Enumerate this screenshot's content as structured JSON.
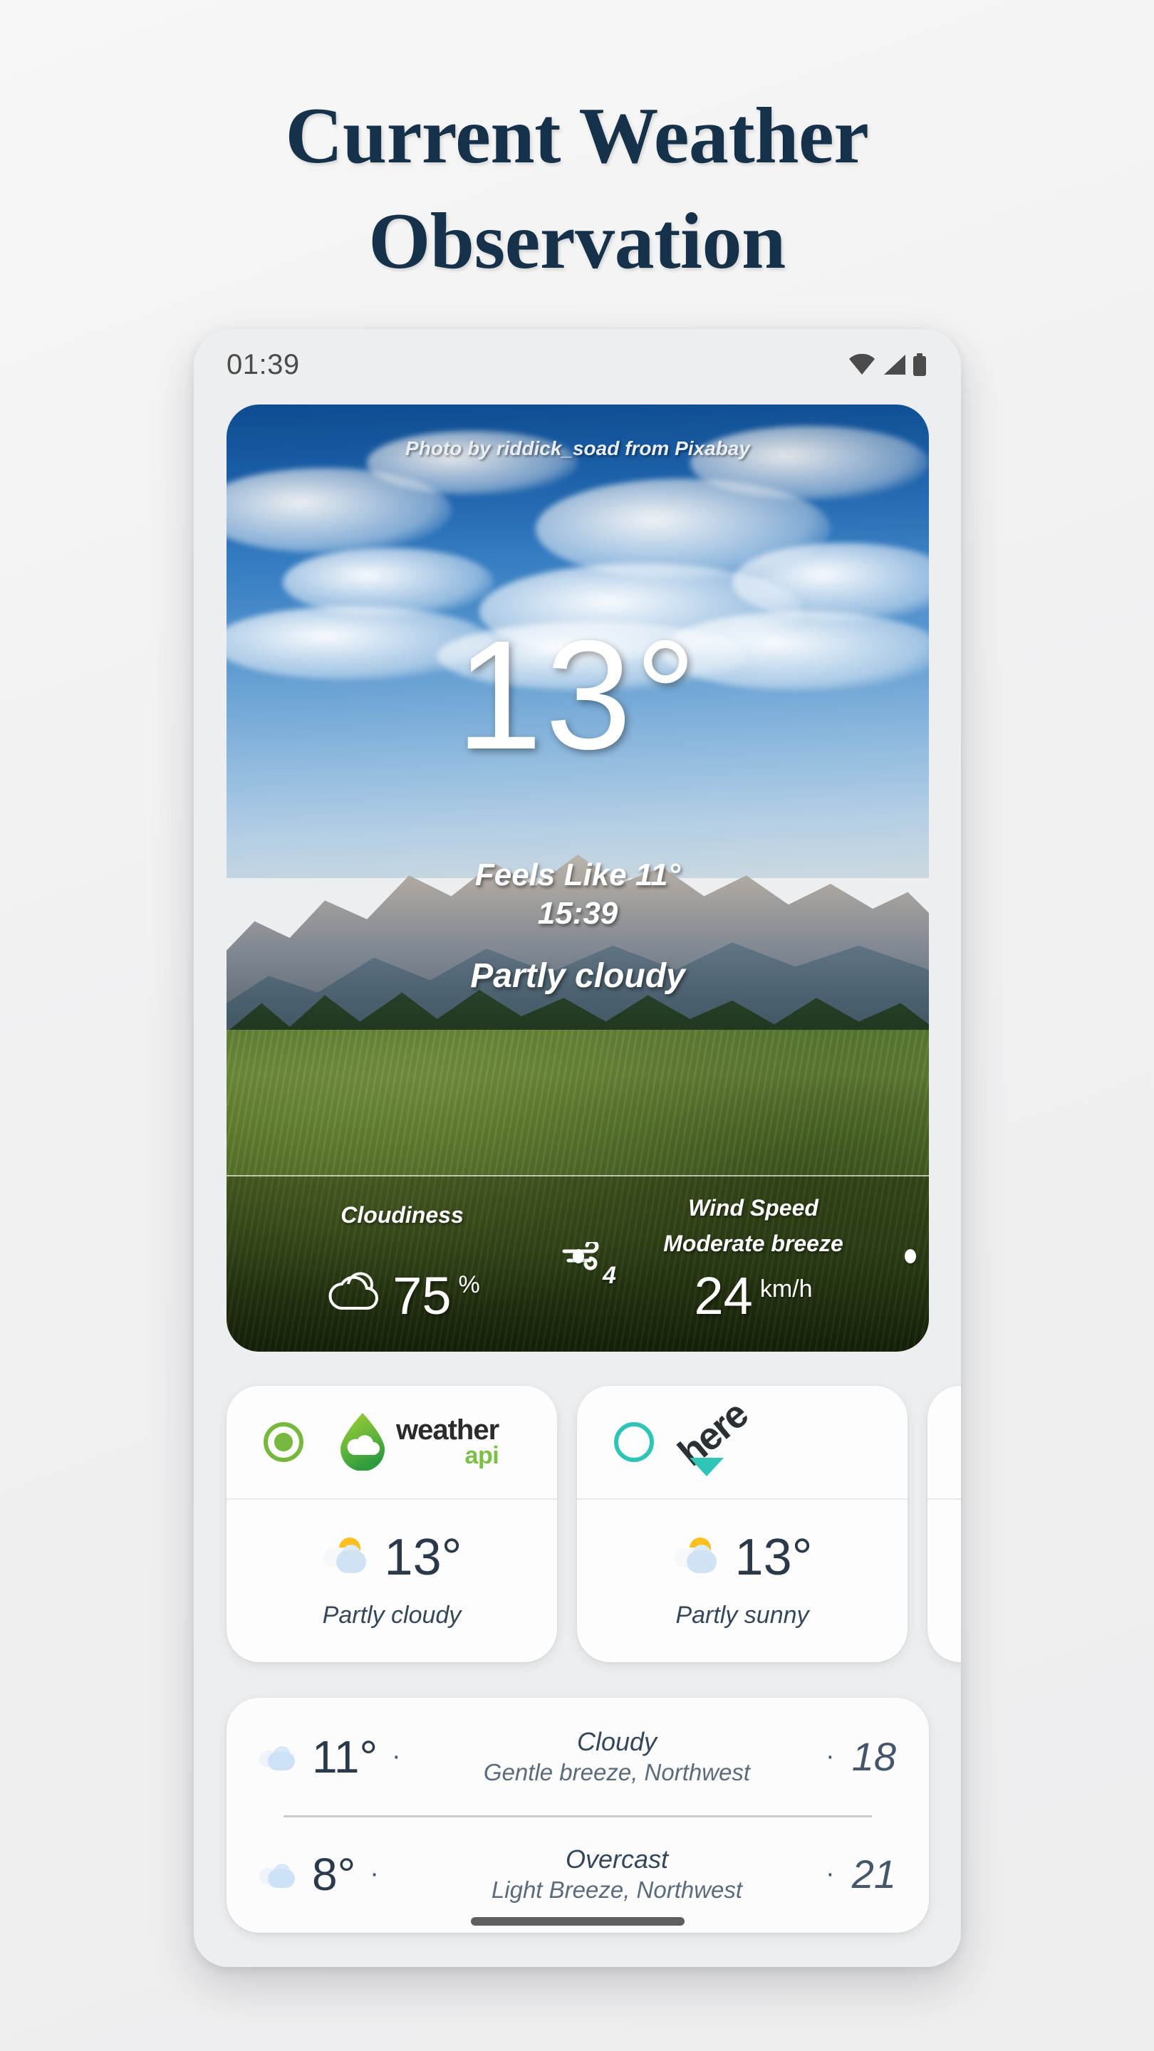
{
  "headline": {
    "line1": "Current Weather",
    "line2": "Observation"
  },
  "phone": {
    "statusbar": {
      "time": "01:39",
      "icons": [
        "wifi-icon",
        "signal-icon",
        "battery-icon"
      ]
    },
    "home_indicator": "home-indicator"
  },
  "hero": {
    "photo_credit": "Photo by riddick_soad from Pixabay",
    "temperature": "13°",
    "feels_like": "Feels Like 11°",
    "observation_time": "15:39",
    "condition": "Partly cloudy",
    "stats": [
      {
        "label": "Cloudiness",
        "sublabel": "",
        "value": "75",
        "unit": "%",
        "icon": "cloud-icon"
      },
      {
        "label": "Wind Speed",
        "sublabel": "Moderate breeze",
        "value": "24",
        "unit": "km/h",
        "icon": "wind-icon",
        "beaufort": "4"
      }
    ]
  },
  "providers": [
    {
      "name": "weatherapi",
      "logo_primary": "weather",
      "logo_secondary": "api",
      "selected": true,
      "accent": "#76b83e",
      "temperature": "13°",
      "condition": "Partly cloudy",
      "icon": "sun-behind-cloud-icon"
    },
    {
      "name": "here",
      "logo_primary": "here",
      "logo_secondary": "",
      "selected": false,
      "accent": "#2ec4b6",
      "temperature": "13°",
      "condition": "Partly sunny",
      "icon": "sun-behind-cloud-icon"
    },
    {
      "name": "third-provider",
      "logo_primary": "",
      "logo_secondary": "",
      "selected": false,
      "accent": "#ef7f52",
      "temperature": "",
      "condition": "",
      "icon": ""
    }
  ],
  "forecast": {
    "rows": [
      {
        "icon": "cloud-icon",
        "temperature": "11°",
        "separator": "·",
        "condition": "Cloudy",
        "wind": "Gentle breeze, Northwest",
        "right_separator": "·",
        "value": "18"
      },
      {
        "icon": "cloud-icon",
        "temperature": "8°",
        "separator": "·",
        "condition": "Overcast",
        "wind": "Light Breeze, Northwest",
        "right_separator": "·",
        "value": "21"
      }
    ]
  },
  "colors": {
    "headline": "#16314a",
    "page_bg": "#f2f2f2",
    "weatherapi_green": "#76b83e",
    "here_teal": "#2ec4b6",
    "third_coral": "#ef7f52",
    "sun_yellow": "#fcbf1e"
  }
}
